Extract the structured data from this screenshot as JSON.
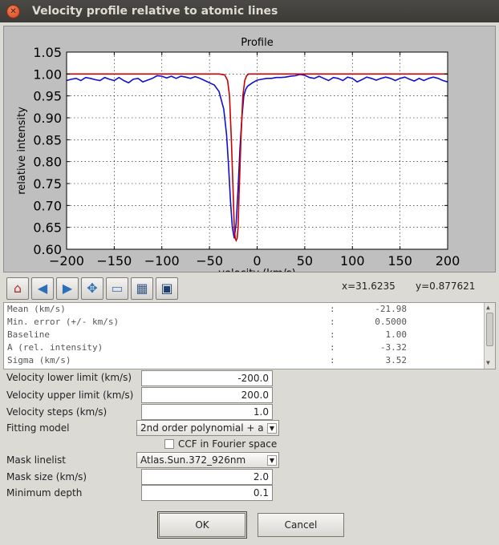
{
  "window": {
    "title": "Velocity profile relative to atomic lines"
  },
  "chart_data": {
    "type": "line",
    "title": "Profile",
    "xlabel": "velocity (km/s)",
    "ylabel": "relative intensity",
    "xlim": [
      -200,
      200
    ],
    "ylim": [
      0.6,
      1.05
    ],
    "xticks": [
      -200,
      -150,
      -100,
      -50,
      0,
      50,
      100,
      150,
      200
    ],
    "yticks": [
      0.6,
      0.65,
      0.7,
      0.75,
      0.8,
      0.85,
      0.9,
      0.95,
      1.0,
      1.05
    ],
    "grid": true,
    "series": [
      {
        "color": "#1010d0",
        "x": [
          -200,
          -195,
          -190,
          -185,
          -180,
          -175,
          -170,
          -165,
          -160,
          -155,
          -150,
          -145,
          -140,
          -135,
          -130,
          -125,
          -120,
          -115,
          -110,
          -105,
          -100,
          -95,
          -90,
          -85,
          -80,
          -75,
          -70,
          -65,
          -60,
          -55,
          -50,
          -45,
          -40,
          -35,
          -32,
          -30,
          -28,
          -26,
          -24,
          -22,
          -20,
          -18,
          -16,
          -14,
          -12,
          -10,
          -5,
          0,
          5,
          10,
          15,
          20,
          25,
          30,
          35,
          40,
          45,
          50,
          55,
          60,
          65,
          70,
          75,
          80,
          85,
          90,
          95,
          100,
          105,
          110,
          115,
          120,
          125,
          130,
          135,
          140,
          145,
          150,
          155,
          160,
          165,
          170,
          175,
          180,
          185,
          190,
          195,
          200
        ],
        "y": [
          0.985,
          0.988,
          0.99,
          0.985,
          0.992,
          0.99,
          0.987,
          0.985,
          0.992,
          0.988,
          0.985,
          0.992,
          0.985,
          0.98,
          0.988,
          0.99,
          0.982,
          0.986,
          0.99,
          0.996,
          0.995,
          0.991,
          0.995,
          0.99,
          0.995,
          0.993,
          0.99,
          0.994,
          0.99,
          0.985,
          0.98,
          0.975,
          0.96,
          0.92,
          0.86,
          0.79,
          0.71,
          0.65,
          0.625,
          0.66,
          0.74,
          0.83,
          0.9,
          0.95,
          0.965,
          0.972,
          0.98,
          0.986,
          0.988,
          0.99,
          0.99,
          0.992,
          0.992,
          0.993,
          0.995,
          0.996,
          0.999,
          0.997,
          0.992,
          0.99,
          0.995,
          0.99,
          0.985,
          0.992,
          0.99,
          0.985,
          0.993,
          0.99,
          0.982,
          0.987,
          0.993,
          0.99,
          0.986,
          0.99,
          0.993,
          0.99,
          0.985,
          0.99,
          0.993,
          0.988,
          0.984,
          0.99,
          0.985,
          0.99,
          0.993,
          0.99,
          0.985,
          0.982
        ]
      },
      {
        "color": "#cc0000",
        "x": [
          -200,
          -40,
          -34,
          -31,
          -29,
          -27,
          -25,
          -24,
          -23,
          -22,
          -21,
          -20,
          -19,
          -17,
          -15,
          -13,
          -11,
          -9,
          -5,
          200
        ],
        "y": [
          1.0,
          1.0,
          0.998,
          0.985,
          0.95,
          0.85,
          0.72,
          0.65,
          0.625,
          0.62,
          0.625,
          0.65,
          0.72,
          0.85,
          0.95,
          0.985,
          0.996,
          1.0,
          1.0,
          1.0
        ]
      }
    ]
  },
  "toolbar": {
    "buttons": [
      {
        "icon": "home-icon",
        "glyph": "⌂"
      },
      {
        "icon": "back-arrow-icon",
        "glyph": "◀"
      },
      {
        "icon": "forward-arrow-icon",
        "glyph": "▶"
      },
      {
        "icon": "pan-move-icon",
        "glyph": "✥"
      },
      {
        "icon": "zoom-rect-icon",
        "glyph": "▭"
      },
      {
        "icon": "configure-subplots-icon",
        "glyph": "▦"
      },
      {
        "icon": "save-floppy-icon",
        "glyph": "▣"
      }
    ],
    "x_readout": "x=31.6235",
    "y_readout": "y=0.877621"
  },
  "stats": [
    {
      "label": "Mean (km/s)",
      "sep": ":",
      "value": "-21.98"
    },
    {
      "label": "Min. error (+/- km/s)",
      "sep": ":",
      "value": "0.5000"
    },
    {
      "label": "Baseline",
      "sep": ":",
      "value": "1.00"
    },
    {
      "label": "A (rel. intensity)",
      "sep": ":",
      "value": "-3.32"
    },
    {
      "label": "Sigma (km/s)",
      "sep": ":",
      "value": "3.52"
    }
  ],
  "form": {
    "vel_lower_label": "Velocity lower limit (km/s)",
    "vel_lower_value": "-200.0",
    "vel_upper_label": "Velocity upper limit (km/s)",
    "vel_upper_value": "200.0",
    "vel_steps_label": "Velocity steps (km/s)",
    "vel_steps_value": "1.0",
    "fitting_label": "Fitting model",
    "fitting_value": "2nd order polynomial + a",
    "ccf_label": "CCF in Fourier space",
    "mask_linelist_label": "Mask linelist",
    "mask_linelist_value": "Atlas.Sun.372_926nm",
    "mask_size_label": "Mask size (km/s)",
    "mask_size_value": "2.0",
    "min_depth_label": "Minimum depth",
    "min_depth_value": "0.1"
  },
  "buttons": {
    "ok": "OK",
    "cancel": "Cancel"
  }
}
